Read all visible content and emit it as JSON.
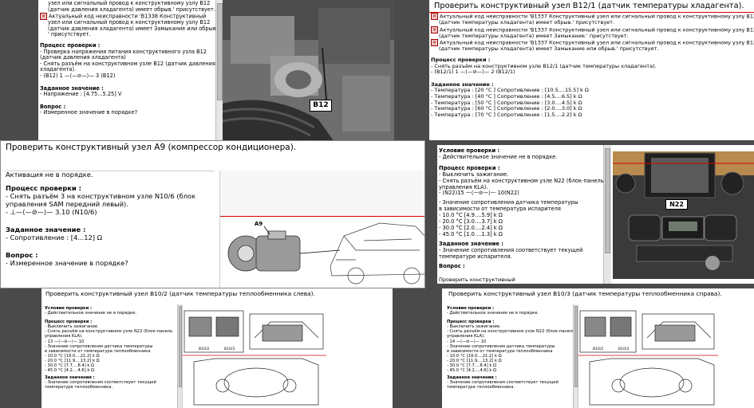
{
  "w1": {
    "lines": [
      "узел или сигнальный провод к конструктивному узлу B12",
      "(датчик давления хладагента) имеет обрыв.' присутствует.",
      "Актуальный код неисправности 'B1338  Конструктивный",
      "узел или сигнальный провод к конструктивному узлу B12",
      "(датчик давления хладагента) имеет Замыкание или обрыв.",
      "' присутствует."
    ],
    "proc_head": "Процесс проверки :",
    "proc": [
      "- Проверка напряжения питания конструктивного узла B12",
      "  (датчик давления хладагента)",
      "- Снять разъём на конструктивном узле B12 (датчик давления",
      "  хладагента).",
      "- (B12) 1 —⟨—⊘—⟩— 3 (B12)"
    ],
    "set_head": "Заданное значение :",
    "set": "- Напряжение : [4.75...5.25] V",
    "q_head": "Вопрос :",
    "q": "- Измеренное значение в порядке?",
    "callout": "B12"
  },
  "w2": {
    "title": "Проверить конструктивный узел B12/1 (датчик температуры хладагента).",
    "lines": [
      "Актуальный код неисправности 'B1337  Конструктивный узел или сигнальный провод к конструктивному узлу B12/1",
      "(датчик температуры хладагента) имеет обрыв.' присутствует.",
      "Актуальный код неисправности 'B1337  Конструктивный узел или сигнальный провод к конструктивному узлу B12/1",
      "(датчик температуры хладагента) имеет Замыкание.' присутствует.",
      "Актуальный код неисправности 'B1337  Конструктивный узел или сигнальный провод к конструктивному узлу B12/1",
      "(датчик температуры хладагента) имеет Замыкание или обрыв.' присутствует."
    ],
    "proc_head": "Процесс проверки :",
    "proc": [
      "- Снять разъём на конструктивном узле B12/1 (датчик температуры хладагента).",
      "- (B12/1) 1 —⟨—⊘—⟩— 2 (B12/1)"
    ],
    "set_head": "Заданное значение :",
    "set": [
      "- Температура : [20 °C ] Сопротивление : [10.5....15.5] k Ω",
      "- Температура : [40 °C ] Сопротивление : [4.5....6.5] k Ω",
      "- Температура : [50 °C ] Сопротивление : [3.0....4.5] k Ω",
      "- Температура : [60 °C ] Сопротивление : [2.0....3.0] k Ω",
      "- Температура : [70 °C ] Сопротивление : [1.5....2.2] k Ω"
    ]
  },
  "w3": {
    "title": "Проверить конструктивный узел A9 (компрессор кондиционера).",
    "line1": "Активация не в порядке.",
    "proc_head": "Процесс проверки :",
    "proc": [
      "- Снять разъём 3 на конструктивном узле N10/6 (блок",
      "  управления SAM передний левый).",
      "- ⊥—⟨—⊘—⟩— 3.10 (N10/6)"
    ],
    "set_head": "Заданное значение :",
    "set": "- Сопротивление : [4...12] Ω",
    "q_head": "Вопрос :",
    "q": "- Измеренное значение в порядке?",
    "callout": "A9"
  },
  "w4": {
    "cond_head": "Условие проверки :",
    "cond": "- Действительное значение не в порядке.",
    "proc_head": "Процесс проверки :",
    "proc": [
      "- Выключить зажигание.",
      "- Снять разъём на конструктивном узле N22 (блок-панель",
      "  управления KLA).",
      "- (N22)15 —⟨—⊘—⟩— 10(N22)"
    ],
    "values": [
      "- Значение сопротивления датчика температуры",
      "  в зависимости от температура испарителя",
      "- 10.0 °C [4.9....5.9] k Ω",
      "- 20.0 °C [3.0....3.7] k Ω",
      "- 30.0 °C [2.0....2.4] k Ω",
      "- 45.0 °C [1.0....1.3] k Ω"
    ],
    "set_head": "Заданное значение :",
    "set": [
      "- Значение сопротивления соответствует текущей",
      "  температуре испарителя."
    ],
    "q_head": "Вопрос :",
    "bottom": "Проверить конструктивный",
    "callout": "N22"
  },
  "w5": {
    "title": "Проверить конструктивный узел B10/2 (датчик температуры теплообменника слева).",
    "cond_head": "Условие проверки :",
    "cond": "- Действительное значение не в порядке.",
    "proc_head": "Процесс проверки :",
    "proc": [
      "- Выключить зажигание.",
      "- Снять разъём на конструктивном узле N22 (блок-панель",
      "  управления KLA).",
      "- 13 —⟨—⊘—⟩— 10"
    ],
    "values": [
      "- Значение сопротивления датчика температуры",
      "  в зависимости от температура теплообменника",
      "- 10.0 °C [19.0....21.2] k Ω",
      "- 20.0 °C [11.9....13.2] k Ω",
      "- 30.0 °C [7.7....8.4] k Ω",
      "- 45.0 °C [4.2....4.6] k Ω"
    ],
    "set_head": "Заданное значение :",
    "set": [
      "- Значение сопротивления соответствует текущей",
      "  температуре теплообменника."
    ]
  },
  "w6": {
    "title": "Проверить конструктивный узел B10/3 (датчик температуры теплообменника справа).",
    "cond_head": "Условие проверки :",
    "cond": "- Действительное значение не в порядке.",
    "proc_head": "Процесс проверки :",
    "proc": [
      "- Выключить зажигание.",
      "- Снять разъём на конструктивном узле N22 (блок-панель",
      "  управления KLA).",
      "- 14 —⟨—⊘—⟩— 10"
    ],
    "values": [
      "- Значение сопротивления датчика температуры",
      "  в зависимости от температура теплообменника",
      "- 10.0 °C [19.0....21.2] k Ω",
      "- 20.0 °C [11.9....13.2] k Ω",
      "- 30.0 °C [7.7....8.4] k Ω",
      "- 45.0 °C [4.2....4.6] k Ω"
    ],
    "set_head": "Заданное значение :",
    "set": [
      "- Значение сопротивления соответствует текущей",
      "  температуре теплообменника."
    ]
  },
  "diag_labels": {
    "b5": [
      "B10/2",
      "B10/3"
    ],
    "b6": [
      "B10/2",
      "B10/3"
    ]
  }
}
